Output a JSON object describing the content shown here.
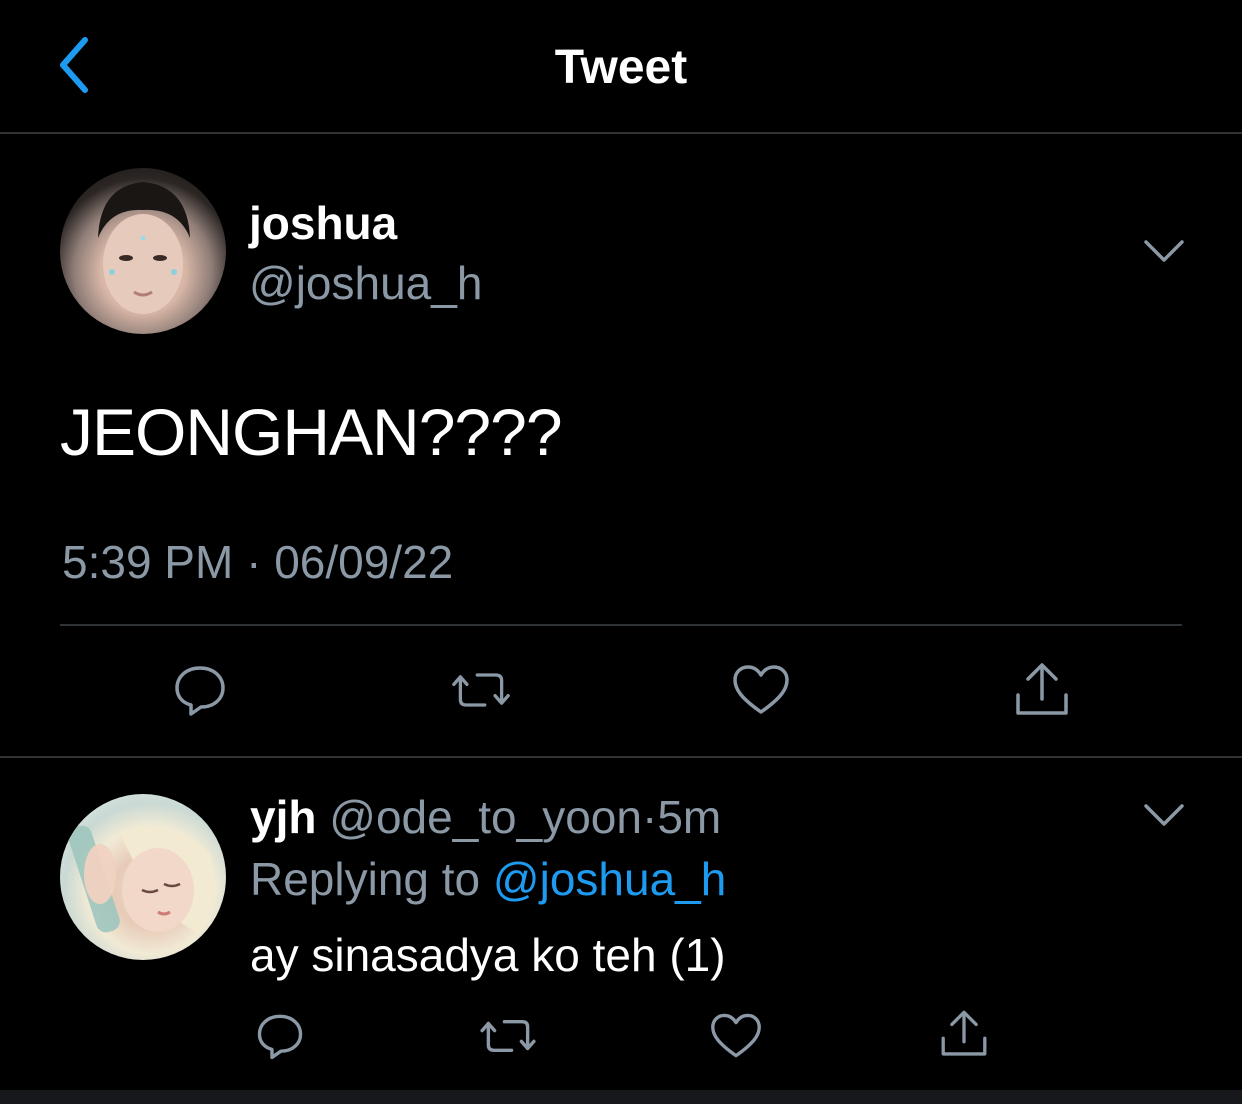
{
  "header": {
    "title": "Tweet",
    "back_icon": "chevron-left-icon"
  },
  "colors": {
    "background": "#000000",
    "text": "#ffffff",
    "secondary": "#8b98a5",
    "accent": "#1d9bf0",
    "divider": "#2f3336"
  },
  "tweet": {
    "display_name": "joshua",
    "handle": "@joshua_h",
    "text": "JEONGHAN????",
    "timestamp": "5:39 PM · 06/09/22",
    "actions": [
      "reply-icon",
      "retweet-icon",
      "like-icon",
      "share-icon"
    ]
  },
  "reply": {
    "display_name": "yjh",
    "handle": "@ode_to_yoon",
    "separator": "·",
    "time": "5m",
    "replying_prefix": "Replying to ",
    "replying_to": "@joshua_h",
    "text": "ay sinasadya ko teh (1)",
    "actions": [
      "reply-icon",
      "retweet-icon",
      "like-icon",
      "share-icon"
    ]
  }
}
